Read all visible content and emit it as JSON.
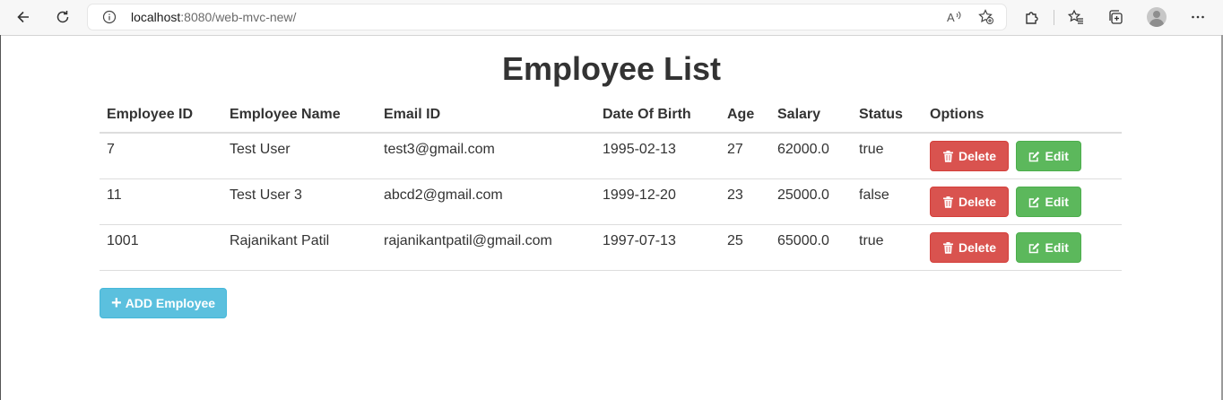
{
  "browser": {
    "url_host": "localhost",
    "url_rest": ":8080/web-mvc-new/"
  },
  "page": {
    "title": "Employee List",
    "columns": [
      "Employee ID",
      "Employee Name",
      "Email ID",
      "Date Of Birth",
      "Age",
      "Salary",
      "Status",
      "Options"
    ],
    "rows": [
      {
        "id": "7",
        "name": "Test User",
        "email": "test3@gmail.com",
        "dob": "1995-02-13",
        "age": "27",
        "salary": "62000.0",
        "status": "true"
      },
      {
        "id": "11",
        "name": "Test User 3",
        "email": "abcd2@gmail.com",
        "dob": "1999-12-20",
        "age": "23",
        "salary": "25000.0",
        "status": "false"
      },
      {
        "id": "1001",
        "name": "Rajanikant Patil",
        "email": "rajanikantpatil@gmail.com",
        "dob": "1997-07-13",
        "age": "25",
        "salary": "65000.0",
        "status": "true"
      }
    ],
    "delete_label": "Delete",
    "edit_label": "Edit",
    "add_label": "ADD Employee"
  },
  "colors": {
    "danger": "#d9534f",
    "success": "#5cb85c",
    "info": "#5bc0de"
  },
  "icons": [
    "back-icon",
    "refresh-icon",
    "info-icon",
    "read-aloud-icon",
    "add-favorite-icon",
    "extensions-icon",
    "favorites-icon",
    "collections-icon",
    "profile-avatar",
    "more-icon",
    "trash-icon",
    "edit-icon",
    "plus-icon"
  ]
}
